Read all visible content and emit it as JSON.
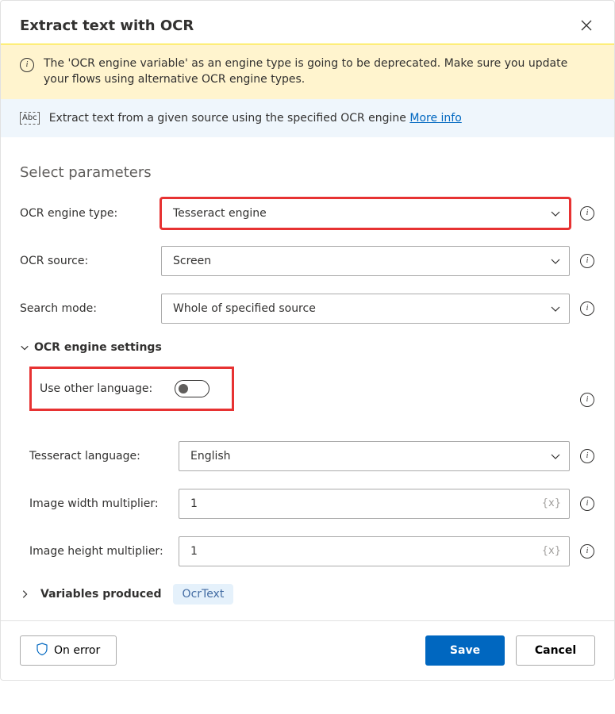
{
  "dialog": {
    "title": "Extract text with OCR"
  },
  "warning": {
    "message": "The 'OCR engine variable' as an engine type is going to be deprecated.  Make sure you update your flows using alternative OCR engine types."
  },
  "description": {
    "abc_label": "Abc",
    "text": "Extract text from a given source using the specified OCR engine ",
    "more_info": "More info"
  },
  "form": {
    "section_title": "Select parameters",
    "ocr_engine_type": {
      "label": "OCR engine type:",
      "value": "Tesseract engine"
    },
    "ocr_source": {
      "label": "OCR source:",
      "value": "Screen"
    },
    "search_mode": {
      "label": "Search mode:",
      "value": "Whole of specified source"
    },
    "engine_settings": {
      "title": "OCR engine settings",
      "use_other_language": {
        "label": "Use other language:"
      },
      "tesseract_language": {
        "label": "Tesseract language:",
        "value": "English"
      },
      "image_width_mult": {
        "label": "Image width multiplier:",
        "value": "1"
      },
      "image_height_mult": {
        "label": "Image height multiplier:",
        "value": "1"
      },
      "var_tag": "{x}"
    },
    "variables_produced": {
      "label": "Variables produced",
      "badge": "OcrText"
    }
  },
  "footer": {
    "on_error": "On error",
    "save": "Save",
    "cancel": "Cancel"
  }
}
